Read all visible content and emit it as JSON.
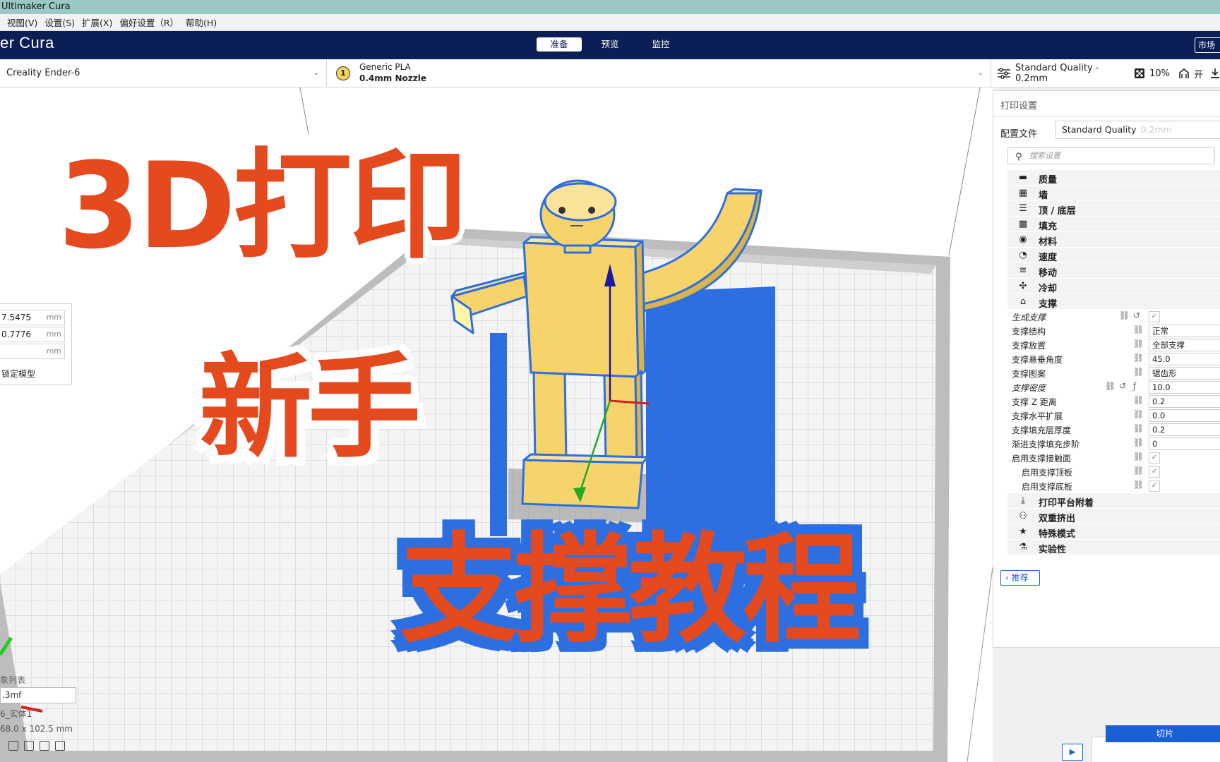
{
  "window": {
    "title": "Ultimaker Cura"
  },
  "menu": [
    "视图(V)",
    "设置(S)",
    "扩展(X)",
    "偏好设置（R）",
    "帮助(H)"
  ],
  "header": {
    "brand": "er Cura",
    "stages": [
      "准备",
      "预览",
      "监控"
    ],
    "active_stage": "准备",
    "marketplace": "市场"
  },
  "toolbar": {
    "printer": "Creality Ender-6",
    "material_badge": "1",
    "material_name": "Generic PLA",
    "nozzle": "0.4mm Nozzle",
    "quality": "Standard Quality - 0.2mm",
    "infill": "10%",
    "support": "开"
  },
  "move_panel": {
    "x": "7.5475",
    "y": "0.7776",
    "z": "",
    "unit": "mm",
    "lock_label": "锁定模型"
  },
  "object_list": {
    "label": "象列表",
    "file": ".3mf",
    "object_name": "6_实体1",
    "dimensions": "68.0 x 102.5 mm"
  },
  "overlay": {
    "line1": "3D打印",
    "line2": "新手",
    "line3": "支撑教程"
  },
  "print_settings": {
    "title": "打印设置",
    "profile_label": "配置文件",
    "profile_value": "Standard Quality",
    "profile_hint": "0.2mm",
    "search_placeholder": "搜索设置",
    "categories_top": [
      {
        "icon": "quality-icon",
        "glyph": "▬",
        "label": "质量"
      },
      {
        "icon": "walls-icon",
        "glyph": "▦",
        "label": "墙"
      },
      {
        "icon": "top-bottom-icon",
        "glyph": "☰",
        "label": "顶 / 底层"
      },
      {
        "icon": "infill-icon",
        "glyph": "▩",
        "label": "填充"
      },
      {
        "icon": "material-icon",
        "glyph": "◉",
        "label": "材料"
      },
      {
        "icon": "speed-icon",
        "glyph": "◔",
        "label": "速度"
      },
      {
        "icon": "travel-icon",
        "glyph": "≋",
        "label": "移动"
      },
      {
        "icon": "cooling-icon",
        "glyph": "✣",
        "label": "冷却"
      },
      {
        "icon": "support-icon",
        "glyph": "⌂",
        "label": "支撑"
      }
    ],
    "support_settings": [
      {
        "label": "生成支撑",
        "italic": true,
        "type": "check",
        "value": "✓"
      },
      {
        "label": "支撑结构",
        "type": "value",
        "value": "正常"
      },
      {
        "label": "支撑放置",
        "type": "value",
        "value": "全部支撑"
      },
      {
        "label": "支撑悬垂角度",
        "type": "value",
        "value": "45.0"
      },
      {
        "label": "支撑图案",
        "type": "value",
        "value": "锯齿形"
      },
      {
        "label": "支撑密度",
        "italic": true,
        "type": "value",
        "value": "10.0"
      },
      {
        "label": "支撑 Z 距离",
        "type": "value",
        "value": "0.2"
      },
      {
        "label": "支撑水平扩展",
        "type": "value",
        "value": "0.0"
      },
      {
        "label": "支撑填充层厚度",
        "type": "value",
        "value": "0.2"
      },
      {
        "label": "渐进支撑填充步阶",
        "type": "value",
        "value": "0"
      },
      {
        "label": "启用支撑接触面",
        "type": "check",
        "value": "✓"
      },
      {
        "label": "启用支撑顶板",
        "indent": true,
        "type": "check",
        "value": "✓"
      },
      {
        "label": "启用支撑底板",
        "indent": true,
        "type": "check",
        "value": "✓"
      }
    ],
    "categories_bottom": [
      {
        "icon": "adhesion-icon",
        "glyph": "⤓",
        "label": "打印平台附着"
      },
      {
        "icon": "dual-extrusion-icon",
        "glyph": "⚇",
        "label": "双重挤出"
      },
      {
        "icon": "special-modes-icon",
        "glyph": "★",
        "label": "特殊模式"
      },
      {
        "icon": "experimental-icon",
        "glyph": "⚗",
        "label": "实验性"
      }
    ],
    "recommended_button": "推荐"
  },
  "slice": {
    "button": "切片",
    "play_icon": "▶"
  },
  "colors": {
    "header_bg": "#0c1e56",
    "accent_blue": "#1a5fd6",
    "model_yellow": "#f7d46b",
    "support_blue": "#2d6fe0",
    "title_orange": "#e5491e"
  }
}
